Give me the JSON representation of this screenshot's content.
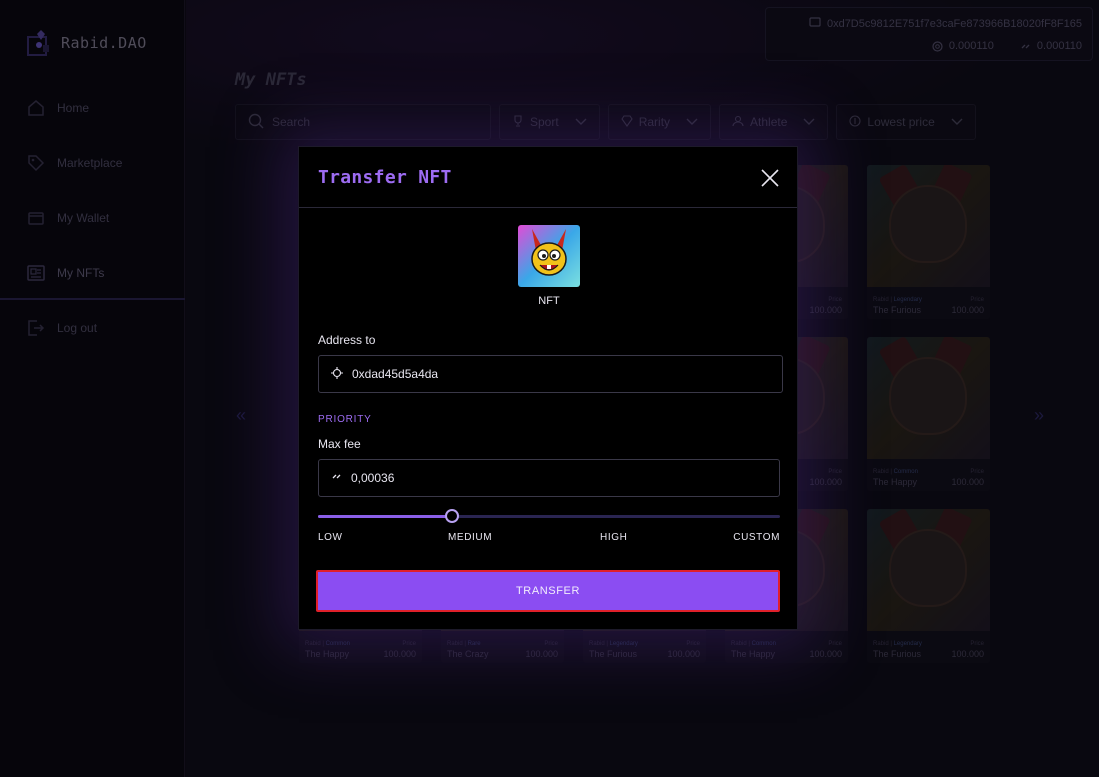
{
  "app": {
    "logo_text": "Rabid.DAO"
  },
  "sidebar": {
    "items": [
      {
        "label": "Home",
        "icon": "home-icon"
      },
      {
        "label": "Marketplace",
        "icon": "tag-icon"
      },
      {
        "label": "My Wallet",
        "icon": "wallet-icon"
      },
      {
        "label": "My NFTs",
        "icon": "nft-icon",
        "active": true
      },
      {
        "label": "Log out",
        "icon": "logout-icon"
      }
    ]
  },
  "header": {
    "wallet_address": "0xd7D5c9812E751f7e3caFe873966B18020fF8F165",
    "balance_1": "0.000110",
    "balance_2": "0.000110"
  },
  "main": {
    "title": "My NFTs",
    "search_placeholder": "Search",
    "filters": [
      "Sport",
      "Rarity",
      "Athlete",
      "Lowest price"
    ],
    "cards": [
      {
        "col": 0,
        "row": 0,
        "rarity_prefix": "",
        "rarity": "",
        "price_label": "",
        "name": "",
        "price": ""
      },
      {
        "col": 1,
        "row": 0,
        "rarity_prefix": "",
        "rarity": "",
        "price_label": "",
        "name": "",
        "price": ""
      },
      {
        "col": 2,
        "row": 0,
        "rarity_prefix": "",
        "rarity": "",
        "price_label": "",
        "name": "",
        "price": ""
      },
      {
        "col": 3,
        "row": 0,
        "rarity_prefix": "",
        "rarity": "",
        "price_label": "Price",
        "name": "",
        "price": "100.000"
      },
      {
        "col": 4,
        "row": 0,
        "rarity_prefix": "Rabid |",
        "rarity": "Legendary",
        "price_label": "Price",
        "name": "The Furious",
        "price": "100.000"
      },
      {
        "col": 0,
        "row": 1,
        "rarity_prefix": "",
        "rarity": "",
        "price_label": "",
        "name": "",
        "price": ""
      },
      {
        "col": 1,
        "row": 1,
        "rarity_prefix": "",
        "rarity": "",
        "price_label": "",
        "name": "",
        "price": ""
      },
      {
        "col": 2,
        "row": 1,
        "rarity_prefix": "",
        "rarity": "",
        "price_label": "",
        "name": "",
        "price": ""
      },
      {
        "col": 3,
        "row": 1,
        "rarity_prefix": "",
        "rarity": "",
        "price_label": "Price",
        "name": "",
        "price": "100.000"
      },
      {
        "col": 4,
        "row": 1,
        "rarity_prefix": "Rabid |",
        "rarity": "Common",
        "price_label": "Price",
        "name": "The Happy",
        "price": "100.000"
      },
      {
        "col": 0,
        "row": 2,
        "rarity_prefix": "Rabid |",
        "rarity": "Common",
        "price_label": "Price",
        "name": "The Happy",
        "price": "100.000"
      },
      {
        "col": 1,
        "row": 2,
        "rarity_prefix": "Rabid |",
        "rarity": "Rare",
        "price_label": "Price",
        "name": "The Crazy",
        "price": "100.000"
      },
      {
        "col": 2,
        "row": 2,
        "rarity_prefix": "Rabid |",
        "rarity": "Legendary",
        "price_label": "Price",
        "name": "The Furious",
        "price": "100.000"
      },
      {
        "col": 3,
        "row": 2,
        "rarity_prefix": "Rabid |",
        "rarity": "Common",
        "price_label": "Price",
        "name": "The Happy",
        "price": "100.000"
      },
      {
        "col": 4,
        "row": 2,
        "rarity_prefix": "Rabid |",
        "rarity": "Legendary",
        "price_label": "Price",
        "name": "The Furious",
        "price": "100.000"
      }
    ]
  },
  "modal": {
    "title": "Transfer NFT",
    "nft_label": "NFT",
    "address_label": "Address to",
    "address_value": "0xdad45d5a4da",
    "priority_label": "PRIORITY",
    "max_fee_label": "Max fee",
    "max_fee_value": "0,00036",
    "slider_labels": [
      "LOW",
      "MEDIUM",
      "HIGH",
      "CUSTOM"
    ],
    "slider_value_fraction": 0.29,
    "transfer_label": "TRANSFER"
  },
  "colors": {
    "accent": "#9d6cf2",
    "button": "#8b4df2",
    "button_highlight_border": "#e0202a"
  }
}
